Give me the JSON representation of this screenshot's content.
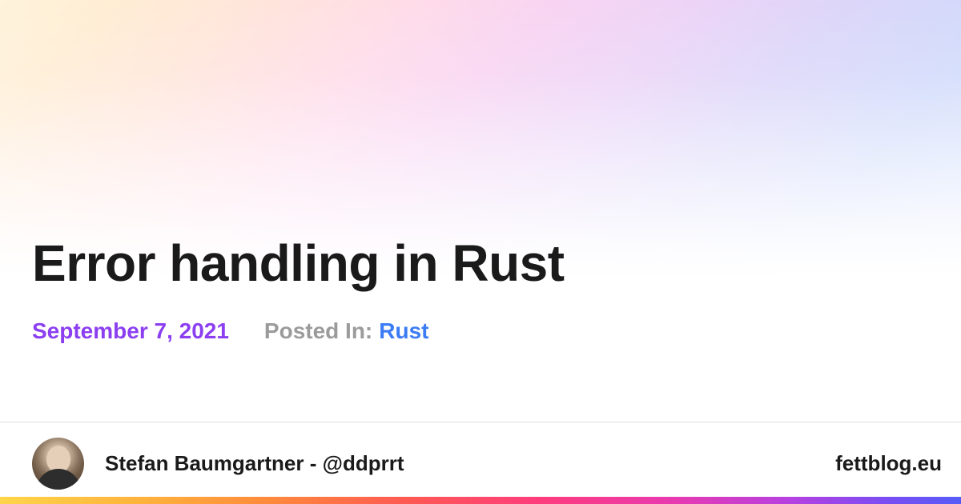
{
  "article": {
    "title": "Error handling in Rust",
    "date": "September 7, 2021",
    "posted_in_label": "Posted In:",
    "category": "Rust"
  },
  "footer": {
    "author": "Stefan Baumgartner - @ddprrt",
    "site": "fettblog.eu"
  }
}
